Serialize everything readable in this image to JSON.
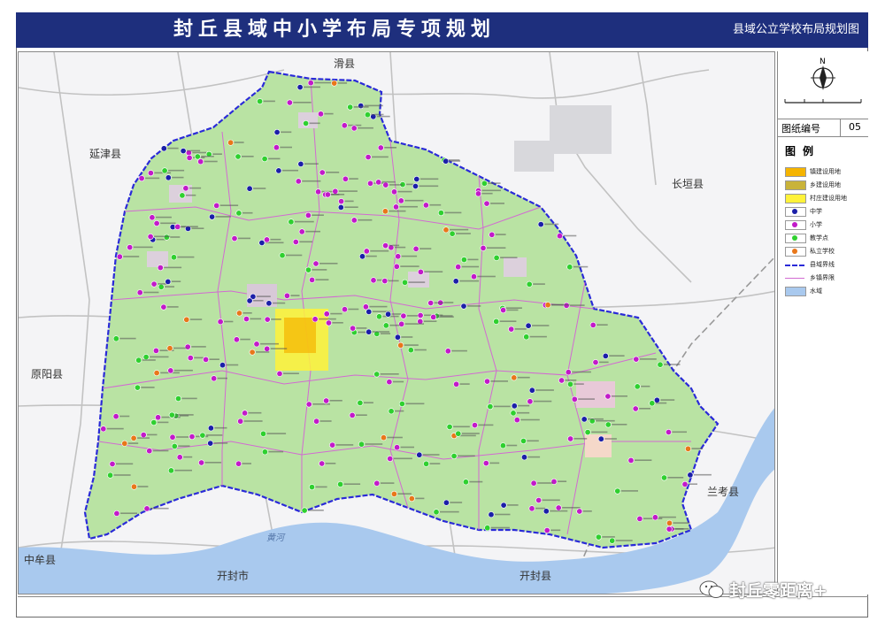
{
  "header": {
    "title": "封丘县域中小学布局专项规划",
    "subtitle": "县域公立学校布局规划图"
  },
  "info_panel": {
    "north_label": "N",
    "sheet_number_label": "图纸编号",
    "sheet_number_value": "05",
    "legend_title": "图例"
  },
  "legend": [
    {
      "label": "镇建设用地",
      "color": "#f5b400",
      "kind": "fill"
    },
    {
      "label": "乡建设用地",
      "color": "#c9b33a",
      "kind": "fill"
    },
    {
      "label": "村庄建设用地",
      "color": "#fff23a",
      "kind": "fill"
    },
    {
      "label": "中学",
      "color": "#1b1fa8",
      "kind": "dot"
    },
    {
      "label": "小学",
      "color": "#c21ac9",
      "kind": "dot"
    },
    {
      "label": "教学点",
      "color": "#2fd02f",
      "kind": "dot"
    },
    {
      "label": "私立学校",
      "color": "#e8771a",
      "kind": "dot"
    },
    {
      "label": "县域界线",
      "color": "#2a2ad8",
      "kind": "dash"
    },
    {
      "label": "乡镇界限",
      "color": "#d26ad2",
      "kind": "line"
    },
    {
      "label": "水域",
      "color": "#a9c9ee",
      "kind": "fill"
    }
  ],
  "map": {
    "neighbors": [
      {
        "id": "hua",
        "name": "滑县"
      },
      {
        "id": "yanjin",
        "name": "延津县"
      },
      {
        "id": "changyuan",
        "name": "长垣县"
      },
      {
        "id": "yuanyang",
        "name": "原阳县"
      },
      {
        "id": "zhongmu",
        "name": "中牟县"
      },
      {
        "id": "kaifengshi",
        "name": "开封市"
      },
      {
        "id": "kaifengxian",
        "name": "开封县"
      },
      {
        "id": "lankao",
        "name": "兰考县"
      }
    ],
    "river_label": "黄河",
    "colors": {
      "county_fill": "#b9e3a3",
      "water": "#a9c9ee",
      "county_border": "#2a2ad8",
      "township_border": "#d26ad2",
      "road": "#b8b8b8"
    }
  },
  "watermark": {
    "text": "封丘零距离+"
  }
}
